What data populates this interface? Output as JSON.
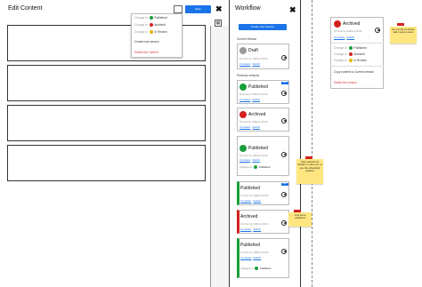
{
  "editor": {
    "title": "Edit Content",
    "save_label": "Save",
    "close_glyph": "✖"
  },
  "dropdown": {
    "rows": [
      {
        "prefix": "Change to",
        "status": "Published",
        "color": "#1a9e3a"
      },
      {
        "prefix": "Change to",
        "status": "Archived",
        "color": "#d42020"
      },
      {
        "prefix": "Change to",
        "status": "In Review",
        "color": "#e5b400"
      }
    ],
    "create_new_version": "Create new version",
    "delete": "Delete the Content"
  },
  "workflow": {
    "title": "Workflow",
    "close_glyph": "✖",
    "create_new_version": "Create new Version",
    "current_version_label": "Current Version",
    "previous_versions_label": "Previous versions",
    "compare": "Compare",
    "switch": "Switch",
    "current": {
      "status": "Draft",
      "meta": "On Feb 11, 2020 at 16:21",
      "color": "#9a9a9a"
    },
    "previous": [
      {
        "status": "Published",
        "meta": "On Feb 11, 2020 at 16:21",
        "color": "#1a9e3a",
        "badge": "NEW"
      },
      {
        "status": "Archived",
        "meta": "On Feb 11, 2020 at 16:21",
        "color": "#d42020"
      },
      {
        "status": "Published",
        "meta": "On Feb 11, 2020 at 16:21",
        "color": "#1a9e3a",
        "change_meta": "Changed to",
        "change_status": "Published"
      },
      {
        "status": "Published",
        "meta": "On Feb 11, 2020 at 16:21",
        "color": "#1a9e3a",
        "badge": "NEW"
      },
      {
        "status": "Archived",
        "meta": "On Feb 11, 2020 at 16:21",
        "color": "#d42020"
      },
      {
        "status": "Published",
        "meta": "On Feb 11, 2020 at 16:21",
        "color": "#1a9e3a",
        "change_meta": "Changed to",
        "change_status": "Published"
      }
    ]
  },
  "mini_panel": {
    "status": "Archived",
    "meta": "On Feb 11, 2020 at 16:21",
    "compare": "Compare",
    "switch": "Switch",
    "rows": [
      {
        "prefix": "Change to",
        "status": "Published",
        "color": "#1a9e3a"
      },
      {
        "prefix": "Change to",
        "status": "Archived",
        "color": "#d42020"
      },
      {
        "prefix": "Change to",
        "status": "In Review",
        "color": "#e5b400"
      }
    ],
    "copy_content": "Copy content to Current version",
    "delete": "Delete the version"
  },
  "notes": {
    "note1": "Item works as button with context menu",
    "note2": "Only relevant for Scadev on dev env. or use the scheduled updates",
    "note3": "Just some variations"
  },
  "colors": {
    "accent": "#1a73e8",
    "published": "#1a9e3a",
    "archived": "#d42020",
    "draft": "#9a9a9a",
    "review": "#e5b400",
    "note": "#ffe680"
  }
}
